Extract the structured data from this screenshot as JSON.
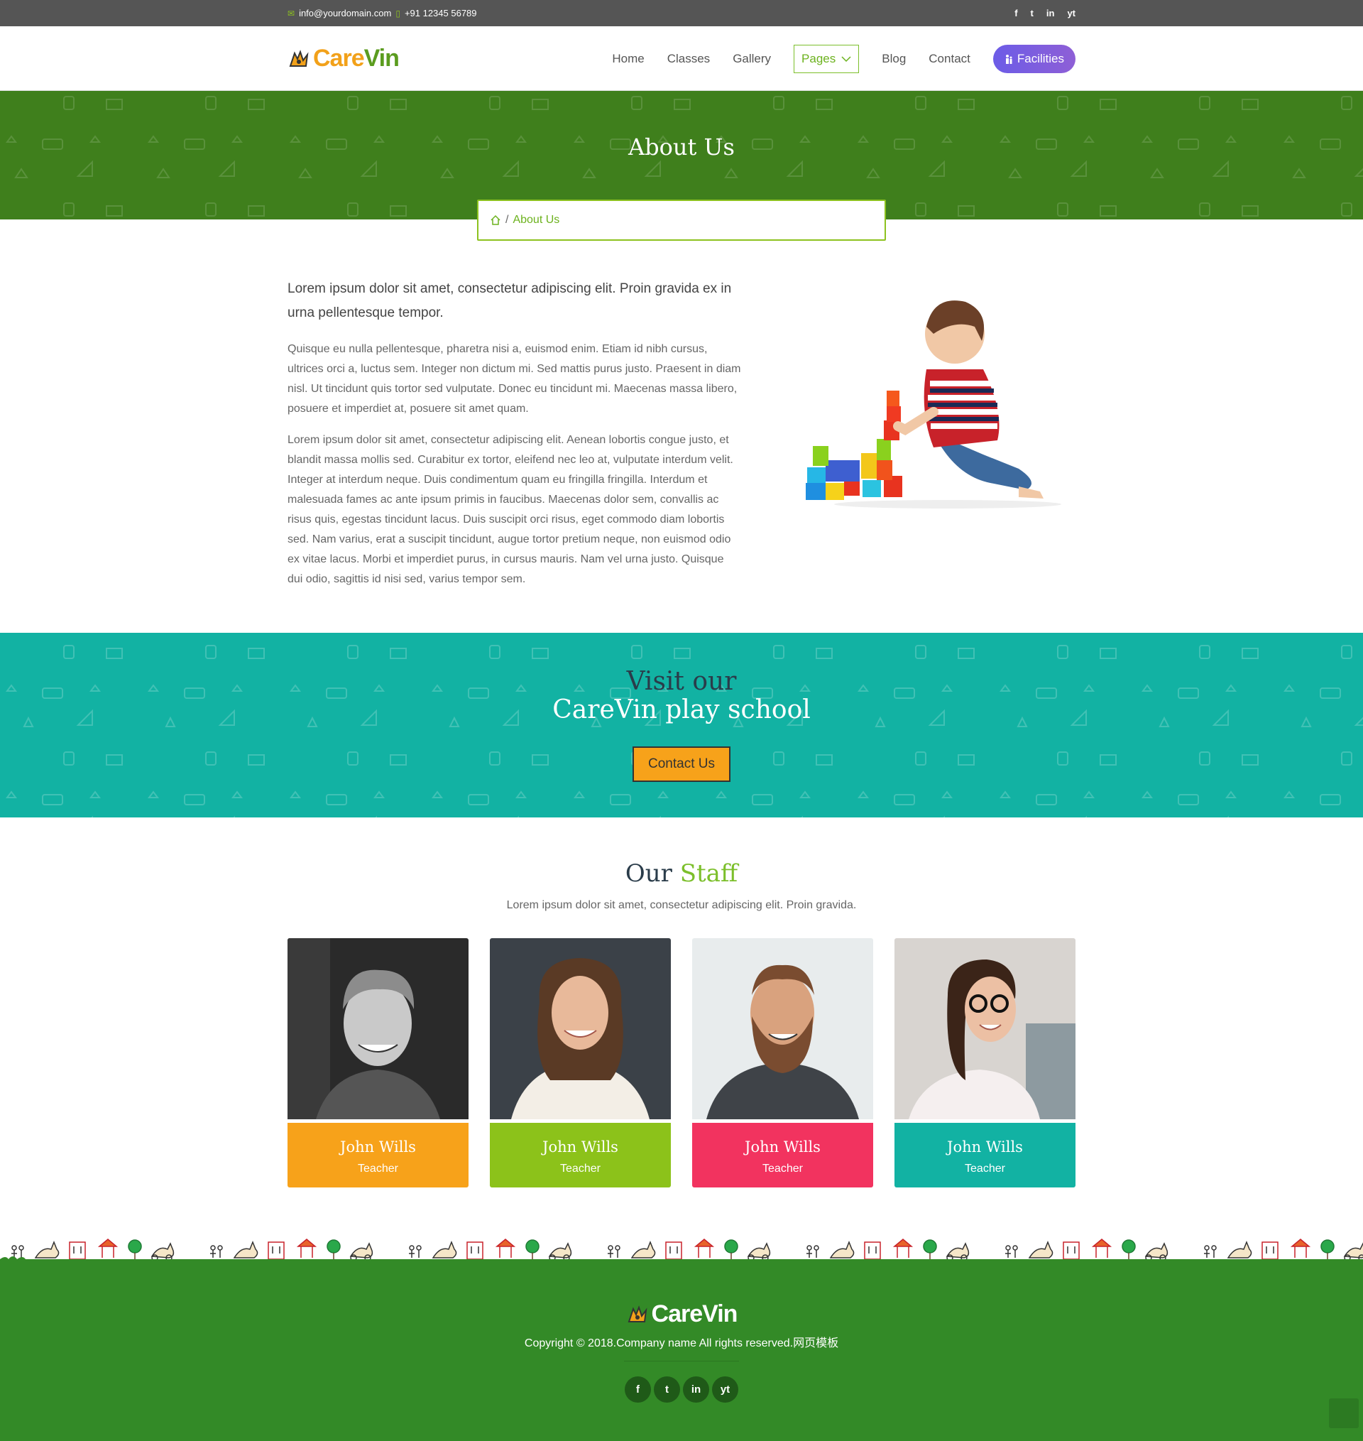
{
  "topbar": {
    "email": "info@yourdomain.com",
    "phone": "+91 12345 56789",
    "social": [
      "f",
      "t",
      "in",
      "yt"
    ]
  },
  "brand": {
    "care": "Care",
    "vin": "Vin"
  },
  "nav": {
    "items": [
      "Home",
      "Classes",
      "Gallery",
      "Pages",
      "Blog",
      "Contact"
    ],
    "facilities": "Facilities"
  },
  "hero": {
    "title": "About Us"
  },
  "breadcrumb": {
    "current": "About Us",
    "separator": "/"
  },
  "about": {
    "lead": "Lorem ipsum dolor sit amet, consectetur adipiscing elit. Proin gravida ex in urna pellentesque tempor.",
    "p1": "Quisque eu nulla pellentesque, pharetra nisi a, euismod enim. Etiam id nibh cursus, ultrices orci a, luctus sem. Integer non dictum mi. Sed mattis purus justo. Praesent in diam nisl. Ut tincidunt quis tortor sed vulputate. Donec eu tincidunt mi. Maecenas massa libero, posuere et imperdiet at, posuere sit amet quam.",
    "p2": "Lorem ipsum dolor sit amet, consectetur adipiscing elit. Aenean lobortis congue justo, et blandit massa mollis sed. Curabitur ex tortor, eleifend nec leo at, vulputate interdum velit. Integer at interdum neque. Duis condimentum quam eu fringilla fringilla. Interdum et malesuada fames ac ante ipsum primis in faucibus. Maecenas dolor sem, convallis ac risus quis, egestas tincidunt lacus. Duis suscipit orci risus, eget commodo diam lobortis sed. Nam varius, erat a suscipit tincidunt, augue tortor pretium neque, non euismod odio ex vitae lacus. Morbi et imperdiet purus, in cursus mauris. Nam vel urna justo. Quisque dui odio, sagittis id nisi sed, varius tempor sem."
  },
  "visit": {
    "line1": "Visit our",
    "line2": "CareVin play school",
    "button": "Contact Us"
  },
  "staff": {
    "title_a": "Our",
    "title_b": "Staff",
    "subtitle": "Lorem ipsum dolor sit amet, consectetur adipiscing elit. Proin gravida.",
    "members": [
      {
        "name": "John Wills",
        "role": "Teacher",
        "color": "#f7a21a"
      },
      {
        "name": "John Wills",
        "role": "Teacher",
        "color": "#8cc21a"
      },
      {
        "name": "John Wills",
        "role": "Teacher",
        "color": "#f2335f"
      },
      {
        "name": "John Wills",
        "role": "Teacher",
        "color": "#12b2a3"
      }
    ]
  },
  "footer": {
    "brand": "CareVin",
    "copyright": "Copyright © 2018.Company name All rights reserved.网页模板",
    "social": [
      "f",
      "t",
      "in",
      "yt"
    ]
  },
  "colors": {
    "green_dark": "#3f7f1c",
    "green_accent": "#8dc21f",
    "teal": "#12b2a3",
    "orange": "#f7a21a",
    "pink": "#f2335f",
    "purple": "#6c5ce7",
    "footer_green": "#338a27"
  }
}
